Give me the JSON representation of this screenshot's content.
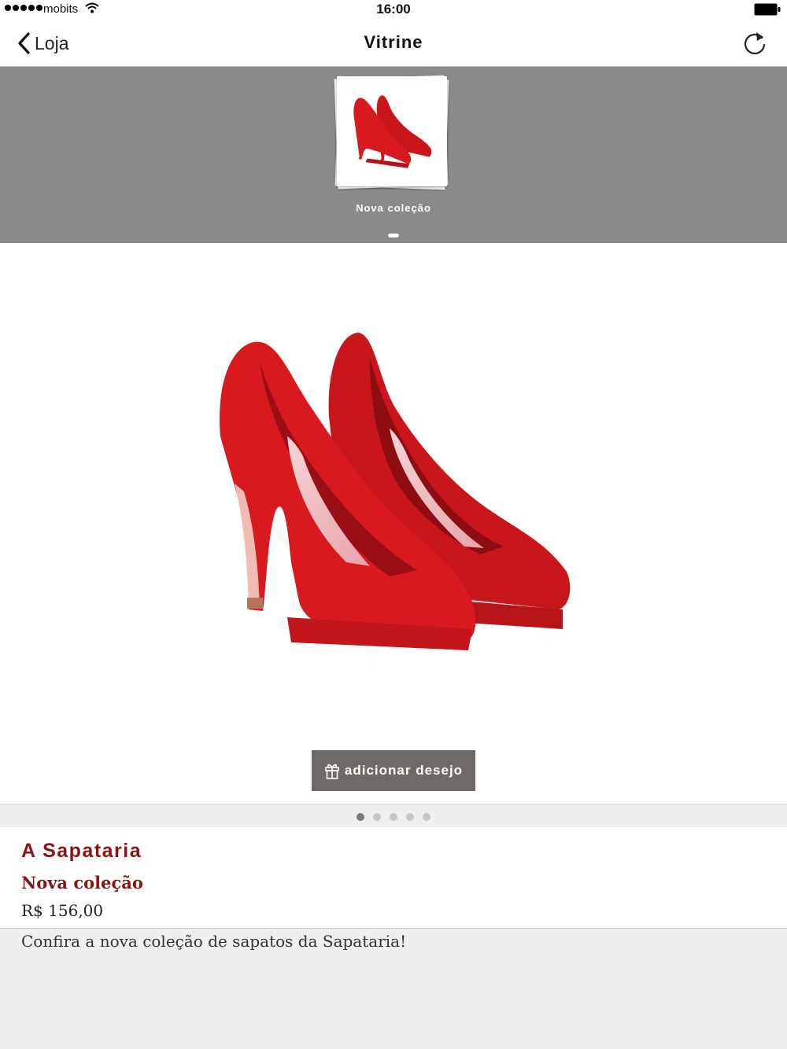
{
  "status_bar": {
    "carrier": "mobits",
    "time": "16:00"
  },
  "nav": {
    "back_label": "Loja",
    "title": "Vitrine"
  },
  "categories": [
    {
      "label": "Nova coleção"
    }
  ],
  "product": {
    "wish_button_label": "adicionar desejo",
    "store_name": "A Sapataria",
    "title": "Nova coleção",
    "price": "R$ 156,00",
    "description": "Confira a nova coleção de sapatos da Sapataria!",
    "image_count": 5,
    "active_image": 1
  },
  "colors": {
    "accent": "#8a1313",
    "strip": "#8c8a88",
    "button": "#6d6a67",
    "shoe": "#d8191d"
  },
  "icons": {
    "back": "chevron-left-icon",
    "refresh": "refresh-icon",
    "wish": "gift-icon"
  }
}
